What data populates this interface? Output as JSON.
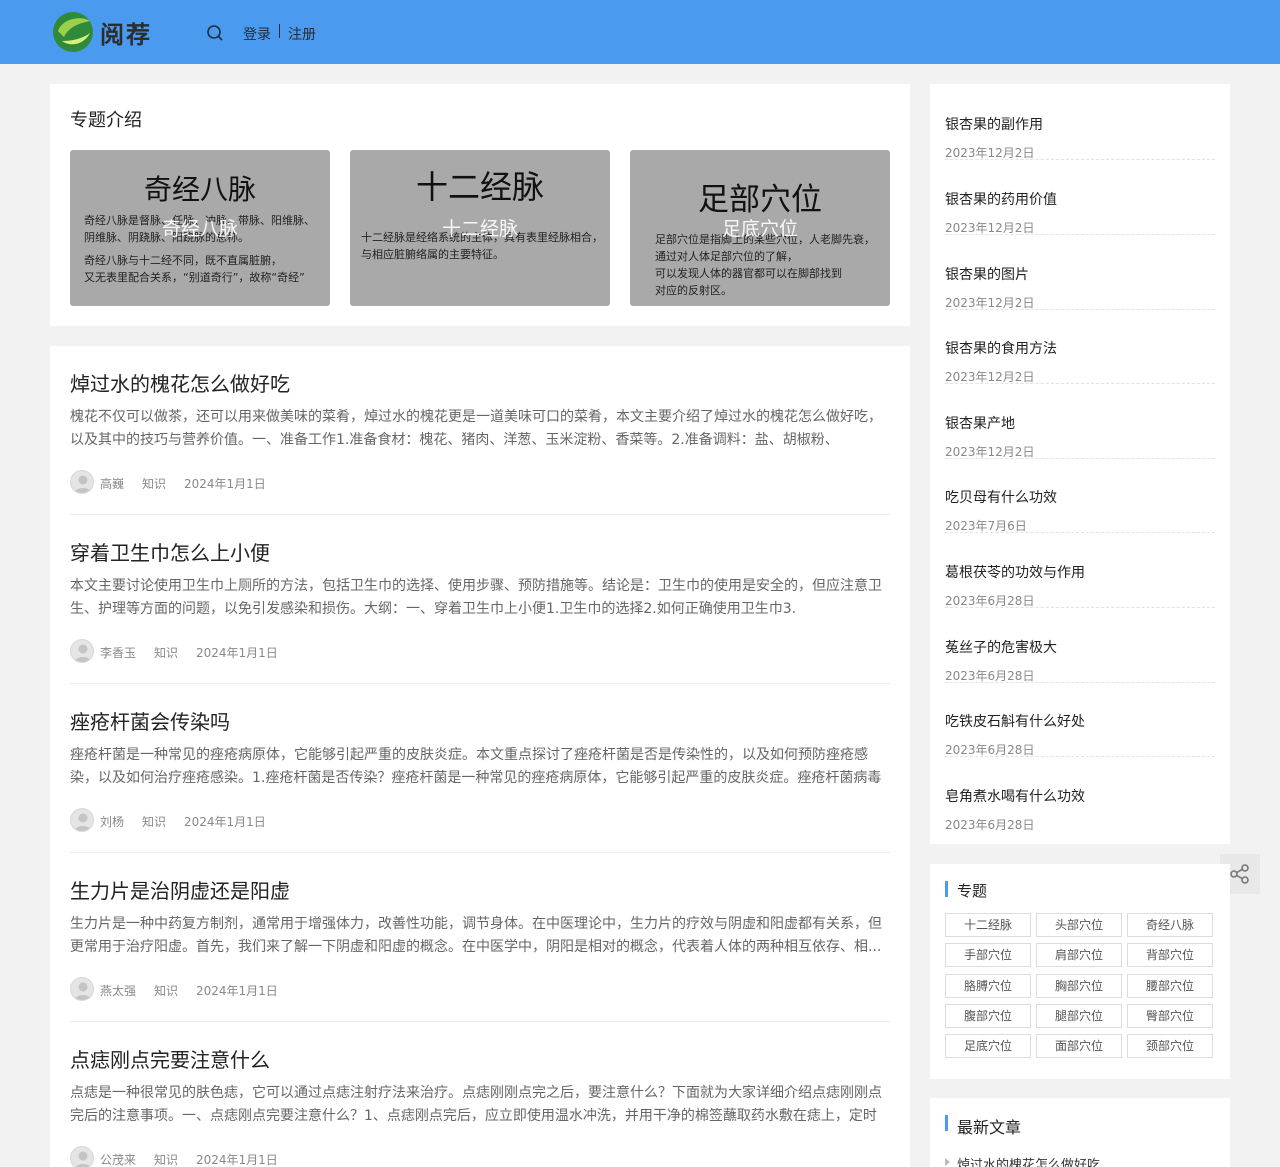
{
  "header": {
    "logo_text": "阅荐",
    "login_label": "登录",
    "register_label": "注册",
    "bg_color": "#4a9bef"
  },
  "topic_intro": {
    "title": "专题介绍",
    "tiles": [
      {
        "heading": "奇经八脉",
        "overlay": "奇经八脉",
        "lines": [
          "奇经八脉是督脉、任脉、冲脉、带脉、阳维脉、",
          "阴维脉、阴跷脉、阳跷脉的总称。",
          "奇经八脉与十二经不同，既不直属脏腑，",
          "又无表里配合关系，“别道奇行”，故称“奇经”"
        ]
      },
      {
        "heading": "十二经脉",
        "overlay": "十二经脉",
        "lines": [
          "十二经脉是经络系统的主体，具有表里经脉相合，",
          "与相应脏腑络属的主要特征。"
        ]
      },
      {
        "heading": "足部穴位",
        "overlay": "足底穴位",
        "lines": [
          "足部穴位是指脚上的某些穴位，人老脚先衰，",
          "通过对人体足部穴位的了解，",
          "可以发现人体的器官都可以在脚部找到",
          "对应的反射区。"
        ]
      }
    ]
  },
  "articles": [
    {
      "title": "焯过水的槐花怎么做好吃",
      "desc": "槐花不仅可以做茶，还可以用来做美味的菜肴，焯过水的槐花更是一道美味可口的菜肴，本文主要介绍了焯过水的槐花怎么做好吃，以及其中的技巧与营养价值。一、准备工作1.准备食材：槐花、猪肉、洋葱、玉米淀粉、香菜等。2.准备调料：盐、胡椒粉、",
      "author": "高巍",
      "category": "知识",
      "date": "2024年1月1日"
    },
    {
      "title": "穿着卫生巾怎么上小便",
      "desc": "本文主要讨论使用卫生巾上厕所的方法，包括卫生巾的选择、使用步骤、预防措施等。结论是：卫生巾的使用是安全的，但应注意卫生、护理等方面的问题，以免引发感染和损伤。大纲：一、穿着卫生巾上小便1.卫生巾的选择2.如何正确使用卫生巾3.",
      "author": "李香玉",
      "category": "知识",
      "date": "2024年1月1日"
    },
    {
      "title": "痤疮杆菌会传染吗",
      "desc": "痤疮杆菌是一种常见的痤疮病原体，它能够引起严重的皮肤炎症。本文重点探讨了痤疮杆菌是否是传染性的，以及如何预防痤疮感染，以及如何治疗痤疮感染。1.痤疮杆菌是否传染？痤疮杆菌是一种常见的痤疮病原体，它能够引起严重的皮肤炎症。痤疮杆菌病毒",
      "author": "刘杨",
      "category": "知识",
      "date": "2024年1月1日"
    },
    {
      "title": "生力片是治阴虚还是阳虚",
      "desc": "生力片是一种中药复方制剂，通常用于增强体力，改善性功能，调节身体。在中医理论中，生力片的疗效与阴虚和阳虚都有关系，但更常用于治疗阳虚。首先，我们来了解一下阴虚和阳虚的概念。在中医学中，阴阳是相对的概念，代表着人体的两种相互依存、相...",
      "author": "燕太强",
      "category": "知识",
      "date": "2024年1月1日"
    },
    {
      "title": "点痣刚点完要注意什么",
      "desc": "点痣是一种很常见的肤色痣，它可以通过点痣注射疗法来治疗。点痣刚刚点完之后，要注意什么？下面就为大家详细介绍点痣刚刚点完后的注意事项。一、点痣刚点完要注意什么？1、点痣刚点完后，应立即使用温水冲洗，并用干净的棉签蘸取药水敷在痣上，定时更",
      "author": "公茂来",
      "category": "知识",
      "date": "2024年1月1日"
    }
  ],
  "sidebar": {
    "items": [
      {
        "title": "银杏果的副作用",
        "date": "2023年12月2日"
      },
      {
        "title": "银杏果的药用价值",
        "date": "2023年12月2日"
      },
      {
        "title": "银杏果的图片",
        "date": "2023年12月2日"
      },
      {
        "title": "银杏果的食用方法",
        "date": "2023年12月2日"
      },
      {
        "title": "银杏果产地",
        "date": "2023年12月2日"
      },
      {
        "title": "吃贝母有什么功效",
        "date": "2023年7月6日"
      },
      {
        "title": "葛根茯苓的功效与作用",
        "date": "2023年6月28日"
      },
      {
        "title": "菟丝子的危害极大",
        "date": "2023年6月28日"
      },
      {
        "title": "吃铁皮石斛有什么好处",
        "date": "2023年6月28日"
      },
      {
        "title": "皂角煮水喝有什么功效",
        "date": "2023年6月28日"
      }
    ],
    "topics_heading": "专题",
    "tags": [
      "十二经脉",
      "头部穴位",
      "奇经八脉",
      "手部穴位",
      "肩部穴位",
      "背部穴位",
      "胳膊穴位",
      "胸部穴位",
      "腰部穴位",
      "腹部穴位",
      "腿部穴位",
      "臀部穴位",
      "足底穴位",
      "面部穴位",
      "颈部穴位"
    ],
    "latest_heading": "最新文章",
    "latest_items": [
      "焯过水的槐花怎么做好吃"
    ]
  }
}
